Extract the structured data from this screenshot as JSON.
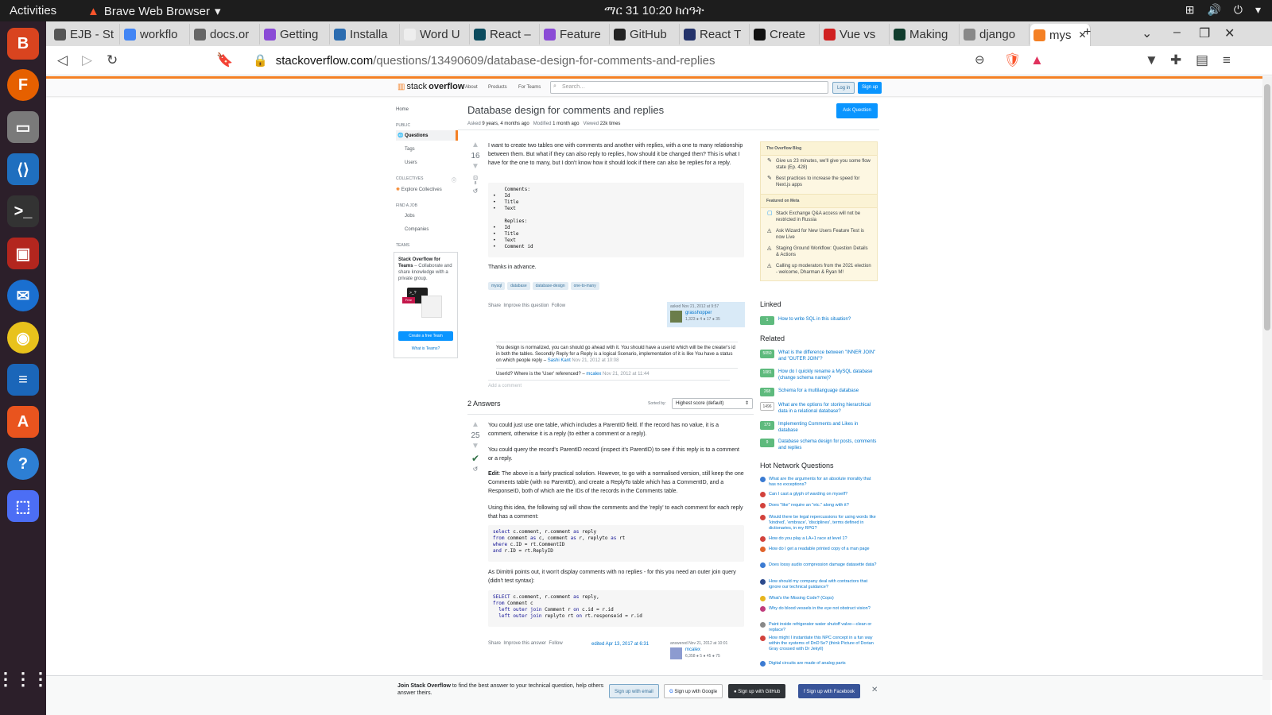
{
  "system": {
    "activities": "Activities",
    "app_name": "Brave Web Browser",
    "clock": "ማር 31  10:20 ከሰዓት"
  },
  "tabs": [
    {
      "label": "EJB - St",
      "color": "#555"
    },
    {
      "label": "workflo",
      "color": "#4285f4"
    },
    {
      "label": "docs.or",
      "color": "#666"
    },
    {
      "label": "Getting",
      "color": "#8a4bd6"
    },
    {
      "label": "Installa",
      "color": "#2b6cb0"
    },
    {
      "label": "Word U",
      "color": "#eee"
    },
    {
      "label": "React –",
      "color": "#0b4b5e"
    },
    {
      "label": "Feature",
      "color": "#8a4bd6"
    },
    {
      "label": "GitHub",
      "color": "#222"
    },
    {
      "label": "React T",
      "color": "#24336b"
    },
    {
      "label": "Create",
      "color": "#111"
    },
    {
      "label": "Vue vs",
      "color": "#d02020"
    },
    {
      "label": "Making",
      "color": "#103c2c"
    },
    {
      "label": "django",
      "color": "#888"
    },
    {
      "label": "mys",
      "color": "#f48024"
    }
  ],
  "address": {
    "domain": "stackoverflow.com",
    "path": "/questions/13490609/database-design-for-comments-and-replies"
  },
  "so_header": {
    "logo_a": "stack",
    "logo_b": "overflow",
    "nav": [
      "About",
      "Products",
      "For Teams"
    ],
    "search_placeholder": "Search…",
    "login": "Log in",
    "signup": "Sign up"
  },
  "left_nav": {
    "home": "Home",
    "public": "PUBLIC",
    "questions": "Questions",
    "tags": "Tags",
    "users": "Users",
    "collectives": "COLLECTIVES",
    "explore": "Explore Collectives",
    "find_job": "FIND A JOB",
    "jobs": "Jobs",
    "companies": "Companies",
    "teams": "TEAMS",
    "teams_title": "Stack Overflow for Teams",
    "teams_desc": "– Collaborate and share knowledge with a private group.",
    "create_team": "Create a free Team",
    "what_teams": "What is Teams?",
    "free_badge": "Free"
  },
  "question": {
    "title": "Database design for comments and replies",
    "asked_label": "Asked",
    "asked": "9 years, 4 months ago",
    "modified_label": "Modified",
    "modified": "1 month ago",
    "viewed_label": "Viewed",
    "viewed": "22k times",
    "ask_button": "Ask Question",
    "votes": "16",
    "bookmarks": "8",
    "body": "I want to create two tables one with comments and another with replies, with a one to many relationship between them. But what if they can also reply to replies, how should it be changed then? This is what I have for the one to many, but I don't know how it should look if there can also be replies for a reply.",
    "code": "    Comments:\n•   Id\n•   Title\n•   Text\n\n    Replies:\n•   Id\n•   Title\n•   Text\n•   Comment id",
    "thanks": "Thanks in advance.",
    "tags": [
      "mysql",
      "database",
      "database-design",
      "one-to-many"
    ],
    "actions": "Share  Improve this question  Follow",
    "asked_card": "asked Nov 21, 2012 at 9:57",
    "user": "grasshopper",
    "user_rep": "1,323 ● 4 ● 17 ● 35",
    "comment1_text": "You design is normalized, you can should go ahead with it. You should have a userId which will be the creater's id in both the tables. Secondly Reply for a Reply is a logical Scenario, implementation of it is like You have a status on which people reply –",
    "comment1_user": "Sashi Kant",
    "comment1_date": "Nov 21, 2012 at 10:08",
    "comment2_text": "UserId? Where is the 'User' referenced? –",
    "comment2_user": "mcalex",
    "comment2_date": "Nov 21, 2012 at 11:44",
    "add_comment": "Add a comment"
  },
  "answers": {
    "count": "2 Answers",
    "sorted_by": "Sorted by:",
    "sort_value": "Highest score (default)",
    "votes": "25",
    "p1": "You could just use one table, which includes a ParentID field. If the record has no value, it is a comment, otherwise it is a reply (to either a comment or a reply).",
    "p2": "You could query the record's ParentID record (inspect it's ParentID) to see if this reply is to a comment or a reply.",
    "edit_label": "Edit",
    "p3": ": The above is a fairly practical solution. However, to go with a normalised version, still keep the one Comments table (with no ParentID), and create a ReplyTo table which has a CommentID, and a ResponseID, both of which are the IDs of the records in the Comments table.",
    "p4": "Using this idea, the following sql will show the comments and the 'reply' to each comment for each reply that has a comment:",
    "code1": "select c.comment, r.comment as reply\nfrom comment as c, comment as r, replyto as rt\nwhere c.ID = rt.CommentID\nand r.ID = rt.ReplyID",
    "p5": "As Dimitrii points out, it won't display comments with no replies - for this you need an outer join query (didn't test syntax):",
    "code2": "SELECT c.comment, r.comment as reply,\nfrom Comment c\n  left outer join Comment r on c.id = r.id\n  left outer join replyto rt on rt.responseid = r.id",
    "actions": "Share  Improve this answer  Follow",
    "edited": "edited Apr 13, 2017 at 6:31",
    "answered": "answered Nov 21, 2012 at 10:01",
    "user": "mcalex",
    "user_rep": "6,358 ● 5 ● 45 ● 75"
  },
  "sidebar": {
    "blog_header": "The Overflow Blog",
    "blog": [
      "Give us 23 minutes, we'll give you some flow state (Ep. 428)",
      "Best practices to increase the speed for Next.js apps"
    ],
    "meta_header": "Featured on Meta",
    "meta": [
      "Stack Exchange Q&A access will not be restricted in Russia",
      "Ask Wizard for New Users Feature Test is now Live",
      "Staging Ground Workflow: Question Details & Actions",
      "Calling up moderators from the 2021 election - welcome, Dharman & Ryan M!"
    ],
    "linked_title": "Linked",
    "linked": [
      {
        "num": "1",
        "text": "How to write SQL in this situation?"
      }
    ],
    "related_title": "Related",
    "related": [
      {
        "num": "5050",
        "text": "What is the difference between \"INNER JOIN\" and \"OUTER JOIN\"?"
      },
      {
        "num": "1081",
        "text": "How do I quickly rename a MySQL database (change schema name)?"
      },
      {
        "num": "268",
        "text": "Schema for a multilanguage database"
      },
      {
        "num": "1496",
        "text": "What are the options for storing hierarchical data in a relational database?"
      },
      {
        "num": "173",
        "text": "Implementing Comments and Likes in database"
      },
      {
        "num": "9",
        "text": "Database schema design for posts, comments and replies"
      }
    ],
    "hnq_title": "Hot Network Questions",
    "hnq": [
      "What are the arguments for an absolute morality that has no exceptions?",
      "Can I cast a glyph of warding on myself?",
      "Does \"like\" require an \"etc.\" along with it?",
      "Would there be legal repercussions for using words like 'kindred', 'embrace', 'disciplines', terms defined in dictionaries, in my RPG?",
      "How do you play a LA+1 race at level 1?",
      "How do I get a readable printed copy of a man page",
      "Does lossy audio compression damage datasette data?",
      "How should my company deal with contractors that ignore our technical guidance?",
      "What's the Missing Code? (Cops)",
      "Why do blood vessels in the eye not obstruct vision?",
      "Paint inside refrigerator water shutoff valve—clean or replace?",
      "How might I instantiate this NPC concept in a fun way within the systems of DnD 5e? (think Picture of Dorian Gray crossed with Dr Jekyll)",
      "Digital circuits are made of analog parts"
    ]
  },
  "signup_bar": {
    "text_bold": "Join Stack Overflow",
    "text": " to find the best answer to your technical question, help others answer theirs.",
    "email": "Sign up with email",
    "google": "Sign up with Google",
    "github": "Sign up with GitHub",
    "facebook": "Sign up with Facebook"
  }
}
